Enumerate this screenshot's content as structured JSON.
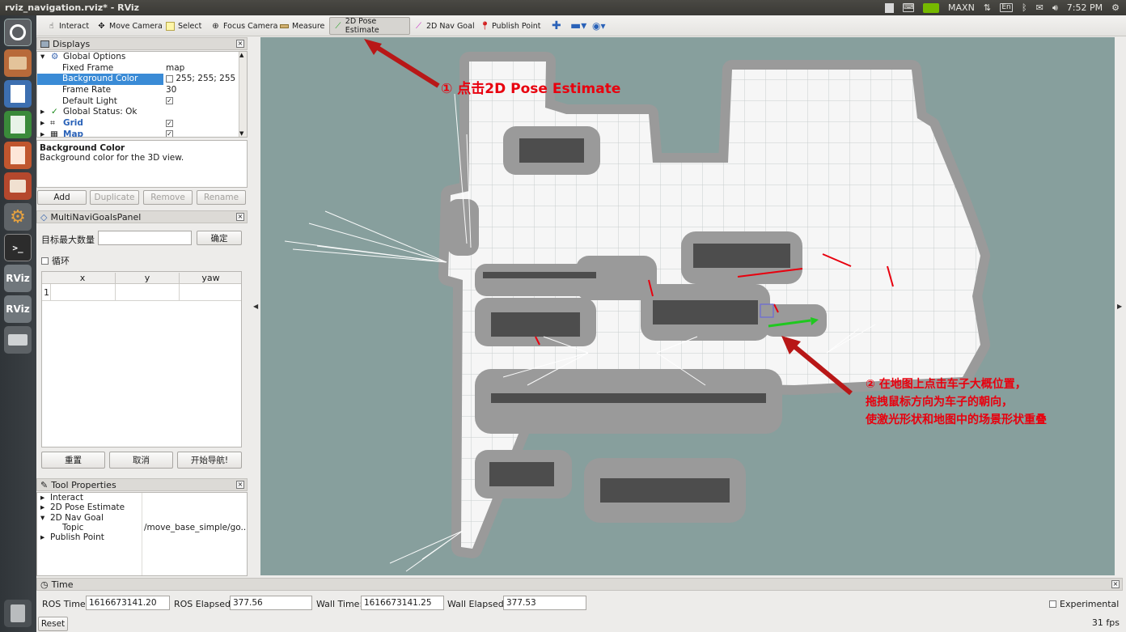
{
  "window_title": "rviz_navigation.rviz* - RViz",
  "tray": {
    "maxn": "MAXN",
    "lang": "En",
    "time": "7:52 PM"
  },
  "launcher": {
    "items": [
      "Dash",
      "Files",
      "Writer",
      "Calc",
      "Impress",
      "Software",
      "Settings",
      "Terminal",
      "RViz",
      "RViz",
      "Drive",
      "Trash"
    ]
  },
  "toolbar": {
    "tools": [
      "Interact",
      "Move Camera",
      "Select",
      "Focus Camera",
      "Measure",
      "2D Pose Estimate",
      "2D Nav Goal",
      "Publish Point"
    ],
    "active": "2D Pose Estimate"
  },
  "displays": {
    "title": "Displays",
    "rows": [
      {
        "label": "Global Options",
        "value": ""
      },
      {
        "label": "Fixed Frame",
        "value": "map"
      },
      {
        "label": "Background Color",
        "value": "255; 255; 255"
      },
      {
        "label": "Frame Rate",
        "value": "30"
      },
      {
        "label": "Default Light",
        "value": "✓"
      },
      {
        "label": "Global Status: Ok",
        "value": ""
      },
      {
        "label": "Grid",
        "value": "✓"
      },
      {
        "label": "Map",
        "value": "✓"
      }
    ],
    "desc_title": "Background Color",
    "desc_text": "Background color for the 3D view.",
    "buttons": {
      "add": "Add",
      "duplicate": "Duplicate",
      "remove": "Remove",
      "rename": "Rename"
    }
  },
  "multi_goal": {
    "title": "MultiNaviGoalsPanel",
    "max_label": "目标最大数量",
    "max_value": "",
    "confirm": "确定",
    "loop": "循环",
    "columns": [
      "x",
      "y",
      "yaw"
    ],
    "row_index": "1",
    "buttons": [
      "重置",
      "取消",
      "开始导航!"
    ]
  },
  "tool_props": {
    "title": "Tool Properties",
    "rows": [
      {
        "label": "Interact",
        "value": ""
      },
      {
        "label": "2D Pose Estimate",
        "value": ""
      },
      {
        "label": "2D Nav Goal",
        "value": ""
      },
      {
        "label": "Topic",
        "value": "/move_base_simple/go..."
      },
      {
        "label": "Publish Point",
        "value": ""
      }
    ]
  },
  "time_panel": {
    "title": "Time",
    "ros_time_label": "ROS Time:",
    "ros_time": "1616673141.20",
    "ros_elapsed_label": "ROS Elapsed:",
    "ros_elapsed": "377.56",
    "wall_time_label": "Wall Time:",
    "wall_time": "1616673141.25",
    "wall_elapsed_label": "Wall Elapsed:",
    "wall_elapsed": "377.53",
    "experimental": "Experimental",
    "reset": "Reset",
    "fps": "31 fps"
  },
  "annotations": {
    "step1": "① 点击2D Pose Estimate",
    "step2_l1": "② 在地图上点击车子大概位置，",
    "step2_l2": "拖拽鼠标方向为车子的朝向，",
    "step2_l3": "使激光形状和地图中的场景形状重叠"
  },
  "colors": {
    "map_bg": "#879f9d",
    "free": "#f6f6f6",
    "inflation": "#9a9a9a",
    "laser": "#e8000e",
    "pose_arrow": "#1fc81f",
    "annotation": "#e8000e"
  }
}
